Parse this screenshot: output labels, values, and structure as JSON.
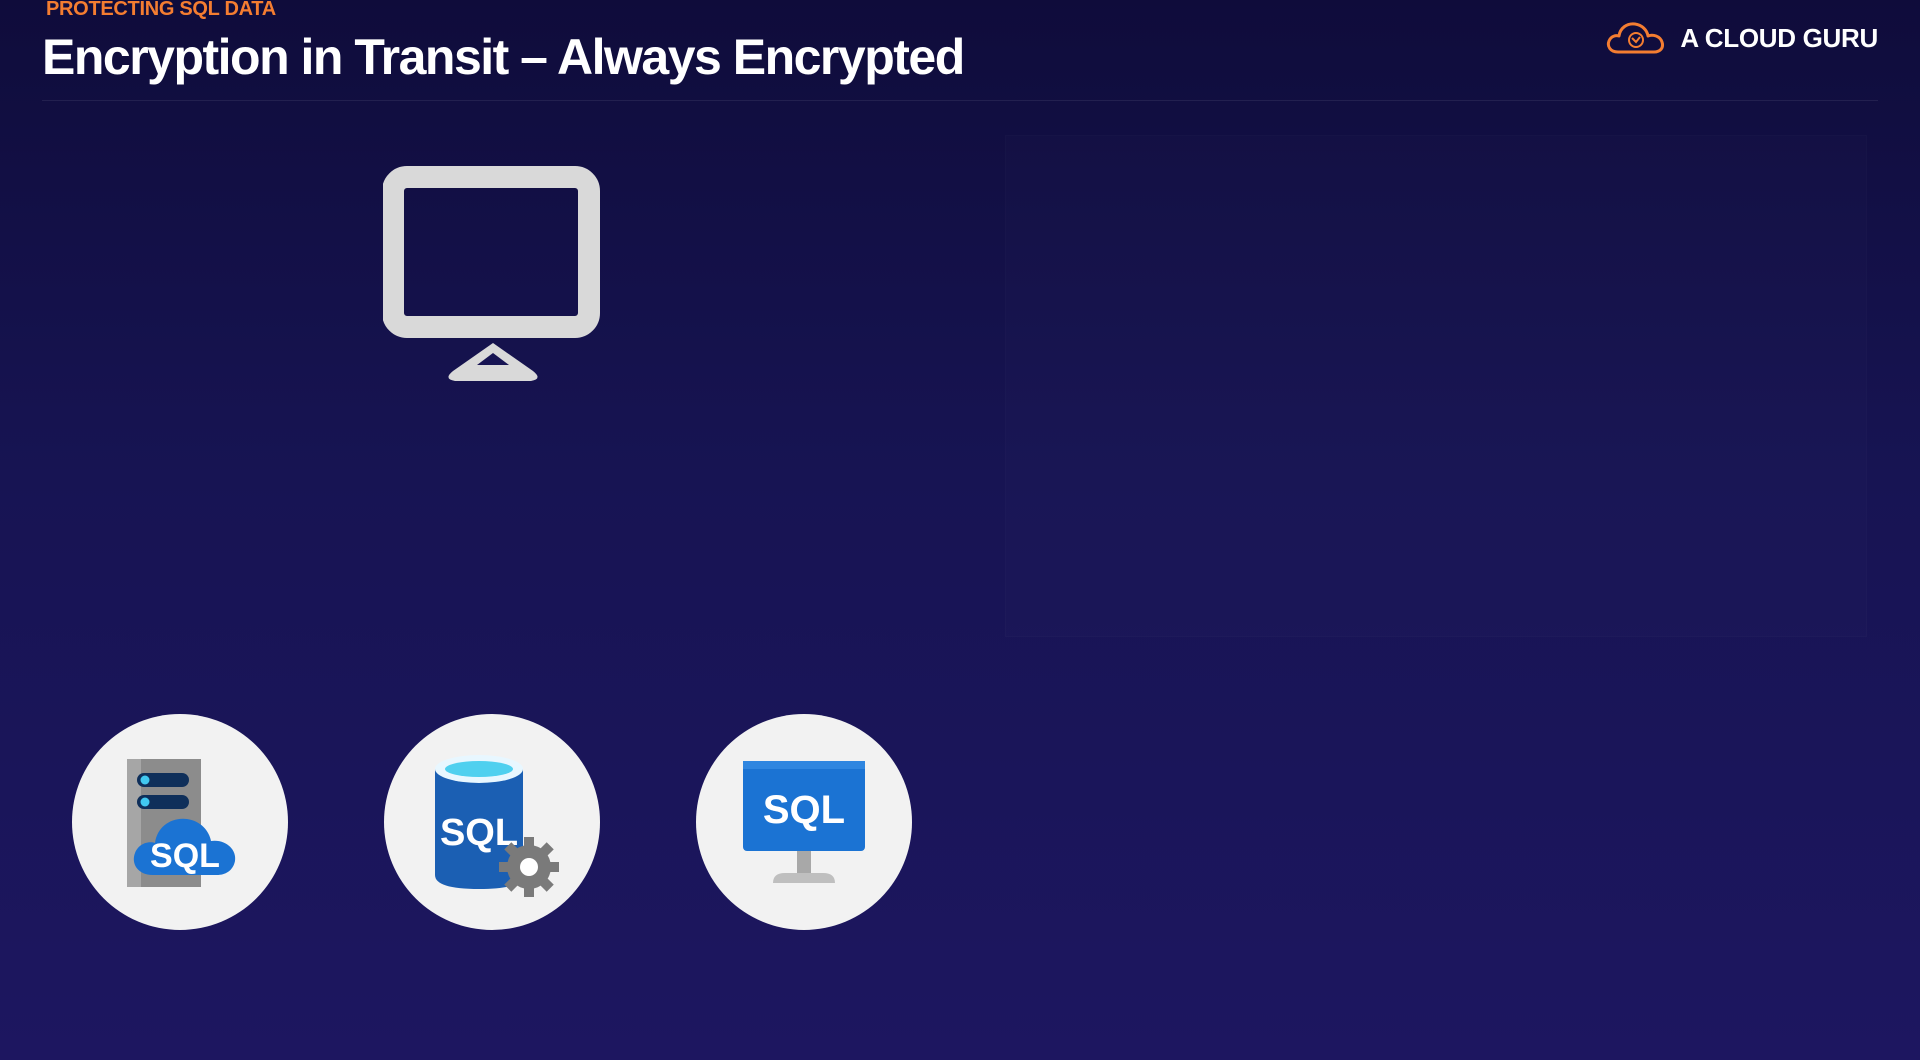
{
  "header": {
    "eyebrow": "PROTECTING SQL DATA",
    "title": "Encryption in Transit – Always Encrypted"
  },
  "brand": {
    "name": "A CLOUD GURU",
    "logo_icon": "cloud-logo-icon",
    "accent_color": "#f47d31"
  },
  "diagram": {
    "client_icon": "monitor-icon",
    "services": [
      {
        "icon": "sql-server-cloud-icon",
        "text": "SQL"
      },
      {
        "icon": "sql-database-icon",
        "text": "SQL"
      },
      {
        "icon": "sql-virtual-machine-icon",
        "text": "SQL"
      }
    ]
  },
  "colors": {
    "background_top": "#0f0c3b",
    "background_bottom": "#1d1660",
    "icon_circle": "#f2f2f2",
    "monitor": "#d9d9d9",
    "azure_blue": "#1b73d3"
  }
}
